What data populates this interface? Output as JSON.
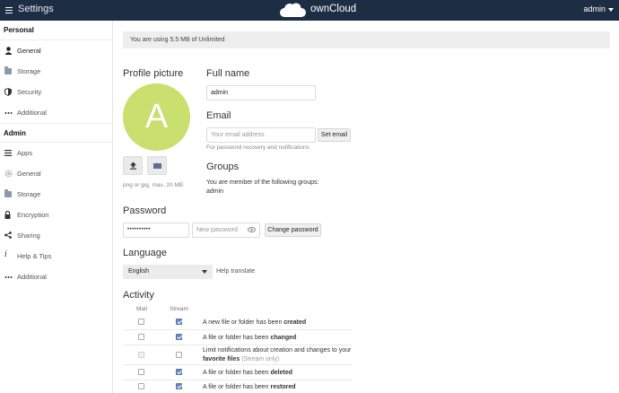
{
  "header": {
    "title": "Settings",
    "brand": "ownCloud",
    "user": "admin"
  },
  "sidebar": {
    "personal_label": "Personal",
    "personal_items": [
      {
        "label": "General",
        "icon": "user-icon"
      },
      {
        "label": "Storage",
        "icon": "folder-icon"
      },
      {
        "label": "Security",
        "icon": "shield-icon"
      },
      {
        "label": "Additional",
        "icon": "more-dots-icon"
      }
    ],
    "admin_label": "Admin",
    "admin_items": [
      {
        "label": "Apps",
        "icon": "apps-list-icon"
      },
      {
        "label": "General",
        "icon": "gear-icon"
      },
      {
        "label": "Storage",
        "icon": "folder-icon"
      },
      {
        "label": "Encryption",
        "icon": "lock-icon"
      },
      {
        "label": "Sharing",
        "icon": "share-icon"
      },
      {
        "label": "Help & Tips",
        "icon": "info-icon"
      },
      {
        "label": "Additional",
        "icon": "more-dots-icon"
      }
    ]
  },
  "quota": "You are using 5.5 MB of Unlimited",
  "profile": {
    "heading": "Profile picture",
    "avatar_letter": "A",
    "avatar_color": "#c9df6e",
    "hint": "png or jpg, max. 20 MB"
  },
  "fullname": {
    "heading": "Full name",
    "value": "admin"
  },
  "email": {
    "heading": "Email",
    "placeholder": "Your email address",
    "button": "Set email",
    "hint": "For password recovery and notifications"
  },
  "groups": {
    "heading": "Groups",
    "text": "You are member of the following groups:",
    "list": "admin"
  },
  "password": {
    "heading": "Password",
    "current_value": "••••••••••",
    "new_placeholder": "New password",
    "button": "Change password"
  },
  "language": {
    "heading": "Language",
    "selected": "English",
    "help_link": "Help translate"
  },
  "activity": {
    "heading": "Activity",
    "col_mail": "Mail",
    "col_stream": "Stream",
    "rows": [
      {
        "pre": "A new file or folder has been ",
        "bold": "created"
      },
      {
        "pre": "A file or folder has been ",
        "bold": "changed"
      },
      {
        "pre": "Limit notifications about creation and changes to your ",
        "bold": "favorite files",
        "note": " (Stream only)"
      },
      {
        "pre": "A file or folder has been ",
        "bold": "deleted"
      },
      {
        "pre": "A file or folder has been ",
        "bold": "restored"
      }
    ]
  }
}
